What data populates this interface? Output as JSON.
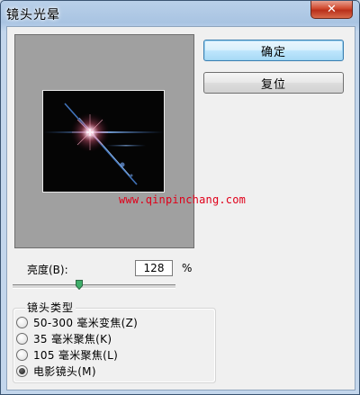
{
  "window": {
    "title": "镜头光晕"
  },
  "buttons": {
    "ok": "确定",
    "reset": "复位"
  },
  "watermark": "www.qinpinchang.com",
  "brightness": {
    "label": "亮度(B):",
    "value": "128",
    "unit": "%",
    "level_percent": 128
  },
  "lens_type": {
    "legend": "镜头类型",
    "options": [
      {
        "label": "50-300 毫米变焦(Z)",
        "selected": false
      },
      {
        "label": "35 毫米聚焦(K)",
        "selected": false
      },
      {
        "label": "105 毫米聚焦(L)",
        "selected": false
      },
      {
        "label": "电影镜头(M)",
        "selected": true
      }
    ]
  },
  "colors": {
    "ok_accent": "#3c7fb1",
    "close_red": "#c8452d",
    "watermark_red": "#e0001a"
  }
}
